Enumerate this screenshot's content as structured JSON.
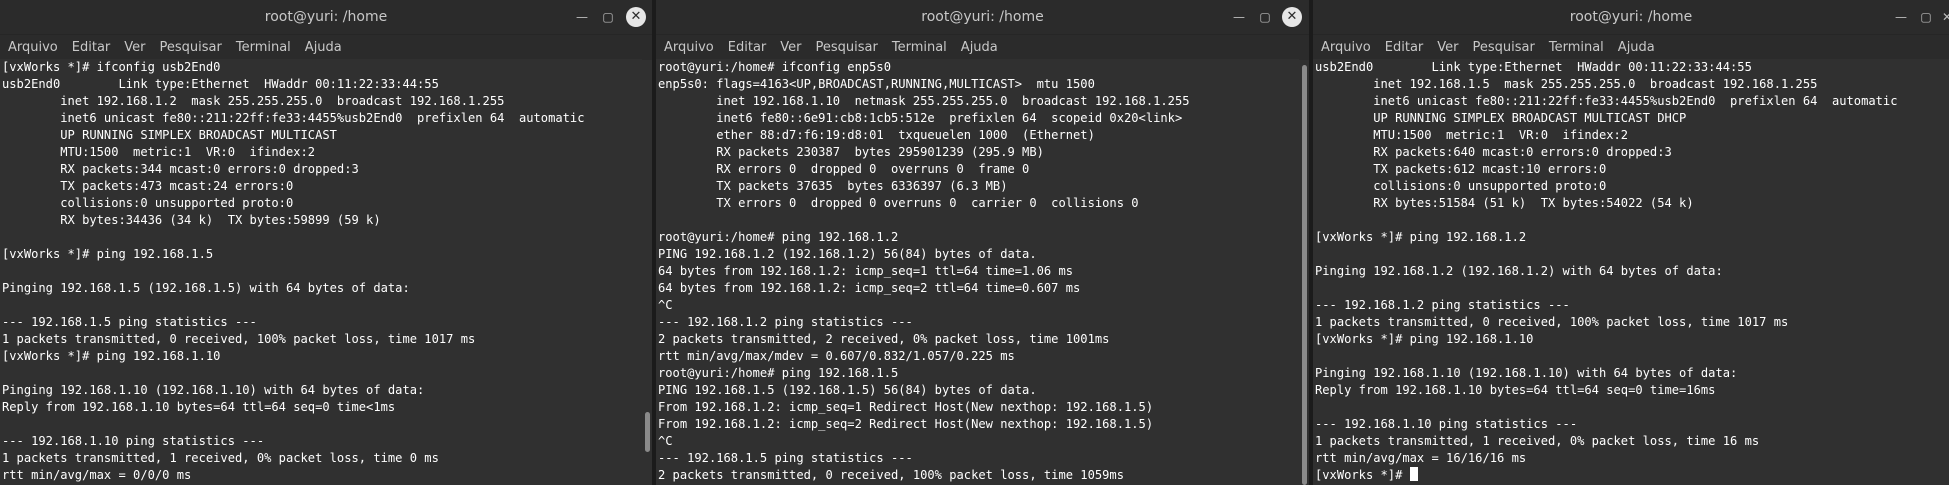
{
  "windows": [
    {
      "title": "root@yuri: /home",
      "menu": [
        "Arquivo",
        "Editar",
        "Ver",
        "Pesquisar",
        "Terminal",
        "Ajuda"
      ],
      "lines": [
        "[vxWorks *]# ifconfig usb2End0",
        "usb2End0        Link type:Ethernet  HWaddr 00:11:22:33:44:55",
        "        inet 192.168.1.2  mask 255.255.255.0  broadcast 192.168.1.255",
        "        inet6 unicast fe80::211:22ff:fe33:4455%usb2End0  prefixlen 64  automatic",
        "        UP RUNNING SIMPLEX BROADCAST MULTICAST",
        "        MTU:1500  metric:1  VR:0  ifindex:2",
        "        RX packets:344 mcast:0 errors:0 dropped:3",
        "        TX packets:473 mcast:24 errors:0",
        "        collisions:0 unsupported proto:0",
        "        RX bytes:34436 (34 k)  TX bytes:59899 (59 k)",
        "",
        "[vxWorks *]# ping 192.168.1.5",
        "",
        "Pinging 192.168.1.5 (192.168.1.5) with 64 bytes of data:",
        "",
        "--- 192.168.1.5 ping statistics ---",
        "1 packets transmitted, 0 received, 100% packet loss, time 1017 ms",
        "[vxWorks *]# ping 192.168.1.10",
        "",
        "Pinging 192.168.1.10 (192.168.1.10) with 64 bytes of data:",
        "Reply from 192.168.1.10 bytes=64 ttl=64 seq=0 time<1ms",
        "",
        "--- 192.168.1.10 ping statistics ---",
        "1 packets transmitted, 1 received, 0% packet loss, time 0 ms",
        "rtt min/avg/max = 0/0/0 ms"
      ]
    },
    {
      "title": "root@yuri: /home",
      "menu": [
        "Arquivo",
        "Editar",
        "Ver",
        "Pesquisar",
        "Terminal",
        "Ajuda"
      ],
      "lines": [
        "root@yuri:/home# ifconfig enp5s0",
        "enp5s0: flags=4163<UP,BROADCAST,RUNNING,MULTICAST>  mtu 1500",
        "        inet 192.168.1.10  netmask 255.255.255.0  broadcast 192.168.1.255",
        "        inet6 fe80::6e91:cb8:1cb5:512e  prefixlen 64  scopeid 0x20<link>",
        "        ether 88:d7:f6:19:d8:01  txqueuelen 1000  (Ethernet)",
        "        RX packets 230387  bytes 295901239 (295.9 MB)",
        "        RX errors 0  dropped 0  overruns 0  frame 0",
        "        TX packets 37635  bytes 6336397 (6.3 MB)",
        "        TX errors 0  dropped 0 overruns 0  carrier 0  collisions 0",
        "",
        "root@yuri:/home# ping 192.168.1.2",
        "PING 192.168.1.2 (192.168.1.2) 56(84) bytes of data.",
        "64 bytes from 192.168.1.2: icmp_seq=1 ttl=64 time=1.06 ms",
        "64 bytes from 192.168.1.2: icmp_seq=2 ttl=64 time=0.607 ms",
        "^C",
        "--- 192.168.1.2 ping statistics ---",
        "2 packets transmitted, 2 received, 0% packet loss, time 1001ms",
        "rtt min/avg/max/mdev = 0.607/0.832/1.057/0.225 ms",
        "root@yuri:/home# ping 192.168.1.5",
        "PING 192.168.1.5 (192.168.1.5) 56(84) bytes of data.",
        "From 192.168.1.2: icmp_seq=1 Redirect Host(New nexthop: 192.168.1.5)",
        "From 192.168.1.2: icmp_seq=2 Redirect Host(New nexthop: 192.168.1.5)",
        "^C",
        "--- 192.168.1.5 ping statistics ---",
        "2 packets transmitted, 0 received, 100% packet loss, time 1059ms"
      ]
    },
    {
      "title": "root@yuri: /home",
      "menu": [
        "Arquivo",
        "Editar",
        "Ver",
        "Pesquisar",
        "Terminal",
        "Ajuda"
      ],
      "lines": [
        "usb2End0        Link type:Ethernet  HWaddr 00:11:22:33:44:55",
        "        inet 192.168.1.5  mask 255.255.255.0  broadcast 192.168.1.255",
        "        inet6 unicast fe80::211:22ff:fe33:4455%usb2End0  prefixlen 64  automatic",
        "        UP RUNNING SIMPLEX BROADCAST MULTICAST DHCP",
        "        MTU:1500  metric:1  VR:0  ifindex:2",
        "        RX packets:640 mcast:0 errors:0 dropped:3",
        "        TX packets:612 mcast:10 errors:0",
        "        collisions:0 unsupported proto:0",
        "        RX bytes:51584 (51 k)  TX bytes:54022 (54 k)",
        "",
        "[vxWorks *]# ping 192.168.1.2",
        "",
        "Pinging 192.168.1.2 (192.168.1.2) with 64 bytes of data:",
        "",
        "--- 192.168.1.2 ping statistics ---",
        "1 packets transmitted, 0 received, 100% packet loss, time 1017 ms",
        "[vxWorks *]# ping 192.168.1.10",
        "",
        "Pinging 192.168.1.10 (192.168.1.10) with 64 bytes of data:",
        "Reply from 192.168.1.10 bytes=64 ttl=64 seq=0 time=16ms",
        "",
        "--- 192.168.1.10 ping statistics ---",
        "1 packets transmitted, 1 received, 0% packet loss, time 16 ms",
        "rtt min/avg/max = 16/16/16 ms",
        "[vxWorks *]# "
      ],
      "cursor": true
    }
  ],
  "window_controls": {
    "minimize_icon": "minimize-icon",
    "maximize_icon": "maximize-icon",
    "close_icon": "close-icon",
    "minimize_glyph": "—",
    "maximize_glyph": "▢",
    "close_glyph": "✕"
  },
  "colors": {
    "terminal_bg": "#303030",
    "terminal_fg": "#ffffff",
    "titlebar_bg": "#2b2b2b"
  }
}
